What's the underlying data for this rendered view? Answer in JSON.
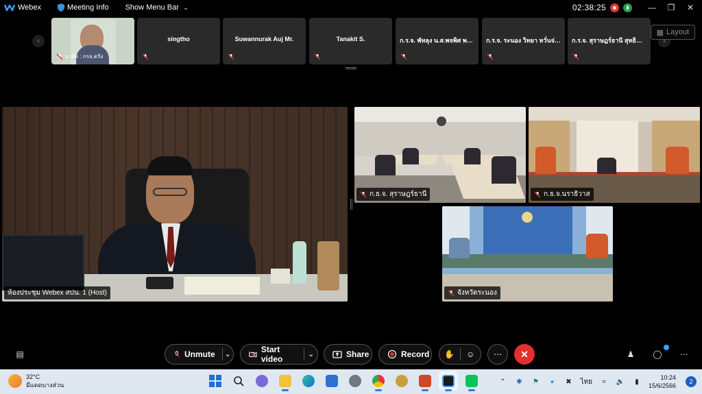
{
  "titlebar": {
    "app_name": "Webex",
    "meeting_info": "Meeting Info",
    "show_menu_bar": "Show Menu Bar",
    "clock": "02:38:25"
  },
  "filmstrip": {
    "layout_label": "Layout",
    "tiles": [
      {
        "name": "",
        "caption": "อาจัด : กรจ.ตรัง",
        "has_video": true
      },
      {
        "name": "singtho",
        "caption": "",
        "has_video": false
      },
      {
        "name": "Suwannurak Auj Mr.",
        "caption": "",
        "has_video": false
      },
      {
        "name": "Tanakit S.",
        "caption": "",
        "has_video": false
      },
      {
        "name": "ก.ร.จ. พัทลุง น.ส.พจพิศ พล...",
        "caption": "",
        "has_video": false
      },
      {
        "name": "ก.ร.จ. ระนอง วิทยา หวั่นจ่าห...",
        "caption": "",
        "has_video": false
      },
      {
        "name": "ก.ร.จ. สุราษฎร์ธานี สุทธินันท์...",
        "caption": "",
        "has_video": false
      }
    ]
  },
  "videos": {
    "main": "ห้องประชุม Webex สปน. 1 (Host)",
    "surat": "ก.ธ.จ. สุราษฎร์ธานี",
    "narathiwat": "ก.ธ.จ.นราธิวาส",
    "ranong": "จังหวัดระนอง"
  },
  "controls": {
    "unmute": "Unmute",
    "start_video": "Start video",
    "share": "Share",
    "record": "Record"
  },
  "taskbar": {
    "temperature": "32°C",
    "weather_desc": "มีแดดบางส่วน",
    "language": "ไทย",
    "time": "10:24",
    "date": "15/6/2566",
    "notifications": "2"
  }
}
